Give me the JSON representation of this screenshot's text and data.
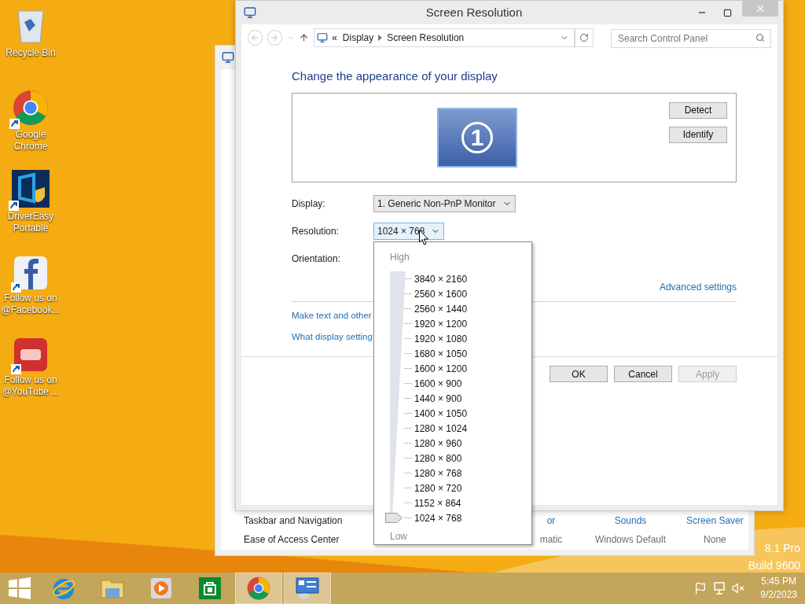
{
  "desktop_icons": [
    {
      "label": "Recycle Bin",
      "kind": "recycle"
    },
    {
      "label": "Google Chrome",
      "kind": "chrome"
    },
    {
      "label": "DriverEasy Portable",
      "kind": "drivereasy"
    },
    {
      "label": "Follow us on @Facebook...",
      "kind": "facebook"
    },
    {
      "label": "Follow us on @YouTube ...",
      "kind": "youtube"
    }
  ],
  "background_window": {
    "items": [
      {
        "label": "Taskbar and Navigation"
      },
      {
        "label": "Ease of Access Center"
      }
    ],
    "settings": [
      {
        "title": "or",
        "value": "matic"
      },
      {
        "title": "Sounds",
        "value": "Windows Default"
      },
      {
        "title": "Screen Saver",
        "value": "None"
      }
    ]
  },
  "window": {
    "title": "Screen Resolution",
    "breadcrumb_prefix": "«",
    "breadcrumb": [
      "Display",
      "Screen Resolution"
    ],
    "search": {
      "placeholder": "Search Control Panel"
    },
    "heading": "Change the appearance of your display",
    "monitor_label": "1",
    "monitor_buttons": [
      {
        "label": "Detect"
      },
      {
        "label": "Identify"
      }
    ],
    "fields": [
      {
        "label": "Display:",
        "value": "1. Generic Non-PnP Monitor"
      },
      {
        "label": "Resolution:",
        "value": "1024 × 768"
      },
      {
        "label": "Orientation:"
      }
    ],
    "advanced_link": "Advanced settings",
    "links": [
      "Make text and other",
      "What display setting"
    ],
    "buttons": [
      {
        "label": "OK",
        "disabled": false
      },
      {
        "label": "Cancel",
        "disabled": false
      },
      {
        "label": "Apply",
        "disabled": true
      }
    ]
  },
  "resolution_menu": {
    "high": "High",
    "low": "Low",
    "options": [
      {
        "label": "3840 × 2160",
        "selected": false
      },
      {
        "label": "2560 × 1600",
        "selected": false
      },
      {
        "label": "2560 × 1440",
        "selected": false
      },
      {
        "label": "1920 × 1200",
        "selected": false
      },
      {
        "label": "1920 × 1080",
        "selected": false
      },
      {
        "label": "1680 × 1050",
        "selected": false
      },
      {
        "label": "1600 × 1200",
        "selected": false
      },
      {
        "label": "1600 × 900",
        "selected": false
      },
      {
        "label": "1440 × 900",
        "selected": false
      },
      {
        "label": "1400 × 1050",
        "selected": false
      },
      {
        "label": "1280 × 1024",
        "selected": false
      },
      {
        "label": "1280 × 960",
        "selected": false
      },
      {
        "label": "1280 × 800",
        "selected": false
      },
      {
        "label": "1280 × 768",
        "selected": false
      },
      {
        "label": "1280 × 720",
        "selected": false
      },
      {
        "label": "1152 × 864",
        "selected": false
      },
      {
        "label": "1024 × 768",
        "selected": true
      }
    ]
  },
  "edition": [
    "8.1 Pro",
    "Build 9600"
  ],
  "taskbar": {
    "apps": [
      {
        "kind": "ie",
        "active": false
      },
      {
        "kind": "explorer",
        "active": false
      },
      {
        "kind": "media",
        "active": false
      },
      {
        "kind": "store",
        "active": false
      },
      {
        "kind": "chrome",
        "active": true
      },
      {
        "kind": "control",
        "active": true
      }
    ],
    "time": "5:45 PM",
    "date": "9/2/2023"
  }
}
